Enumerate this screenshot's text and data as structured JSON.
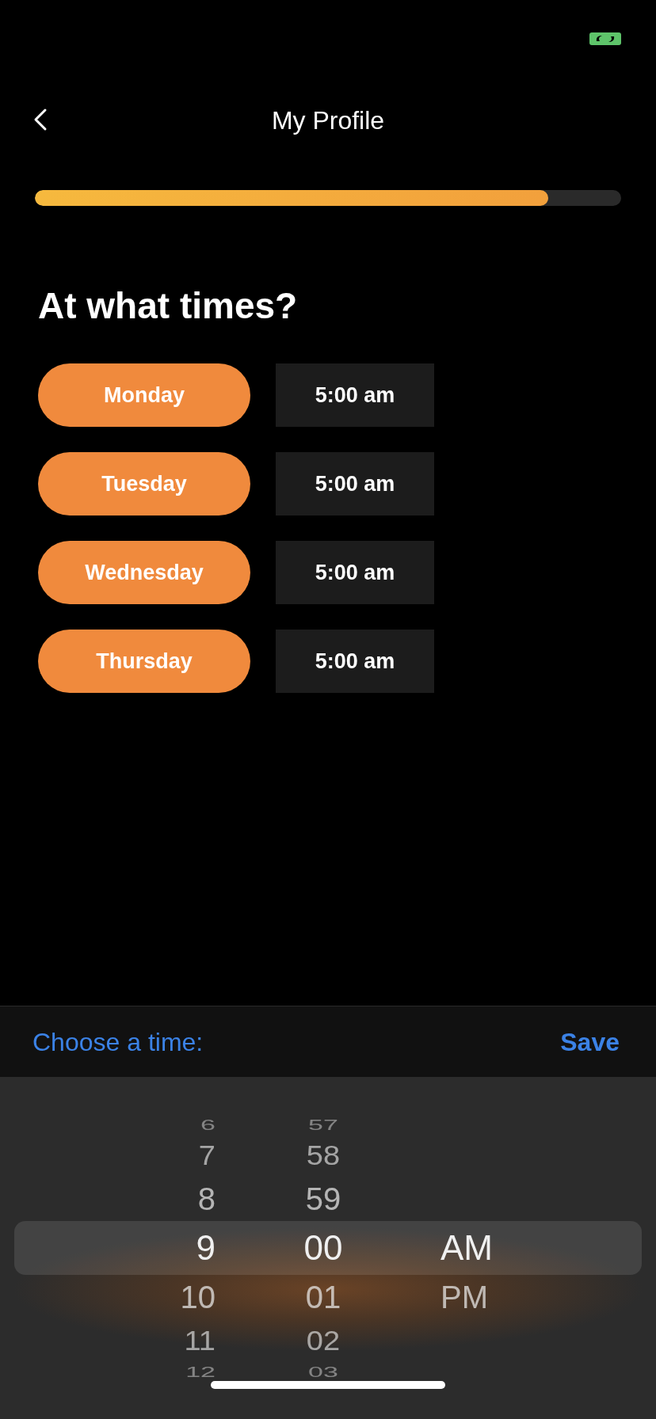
{
  "header": {
    "title": "My Profile",
    "progress": {
      "level": 0.875
    }
  },
  "question": "At what times?",
  "schedule": [
    {
      "day": "Monday",
      "time": "5:00 am"
    },
    {
      "day": "Tuesday",
      "time": "5:00 am"
    },
    {
      "day": "Wednesday",
      "time": "5:00 am"
    },
    {
      "day": "Thursday",
      "time": "5:00 am"
    }
  ],
  "toolbar": {
    "prompt": "Choose a time:",
    "save": "Save"
  },
  "picker": {
    "columns": [
      {
        "kind": "hour",
        "items": [
          {
            "text": "6",
            "selected": false
          },
          {
            "text": "7",
            "selected": false
          },
          {
            "text": "8",
            "selected": false
          },
          {
            "text": "9",
            "selected": true
          },
          {
            "text": "10",
            "selected": false
          },
          {
            "text": "11",
            "selected": false
          },
          {
            "text": "12",
            "selected": false
          }
        ]
      },
      {
        "kind": "minute",
        "items": [
          {
            "text": "57",
            "selected": false
          },
          {
            "text": "58",
            "selected": false
          },
          {
            "text": "59",
            "selected": false
          },
          {
            "text": "00",
            "selected": true
          },
          {
            "text": "01",
            "selected": false
          },
          {
            "text": "02",
            "selected": false
          },
          {
            "text": "03",
            "selected": false
          }
        ]
      },
      {
        "kind": "period",
        "items": [
          {
            "text": "AM",
            "selected": true
          },
          {
            "text": "PM",
            "selected": false
          }
        ]
      }
    ]
  }
}
